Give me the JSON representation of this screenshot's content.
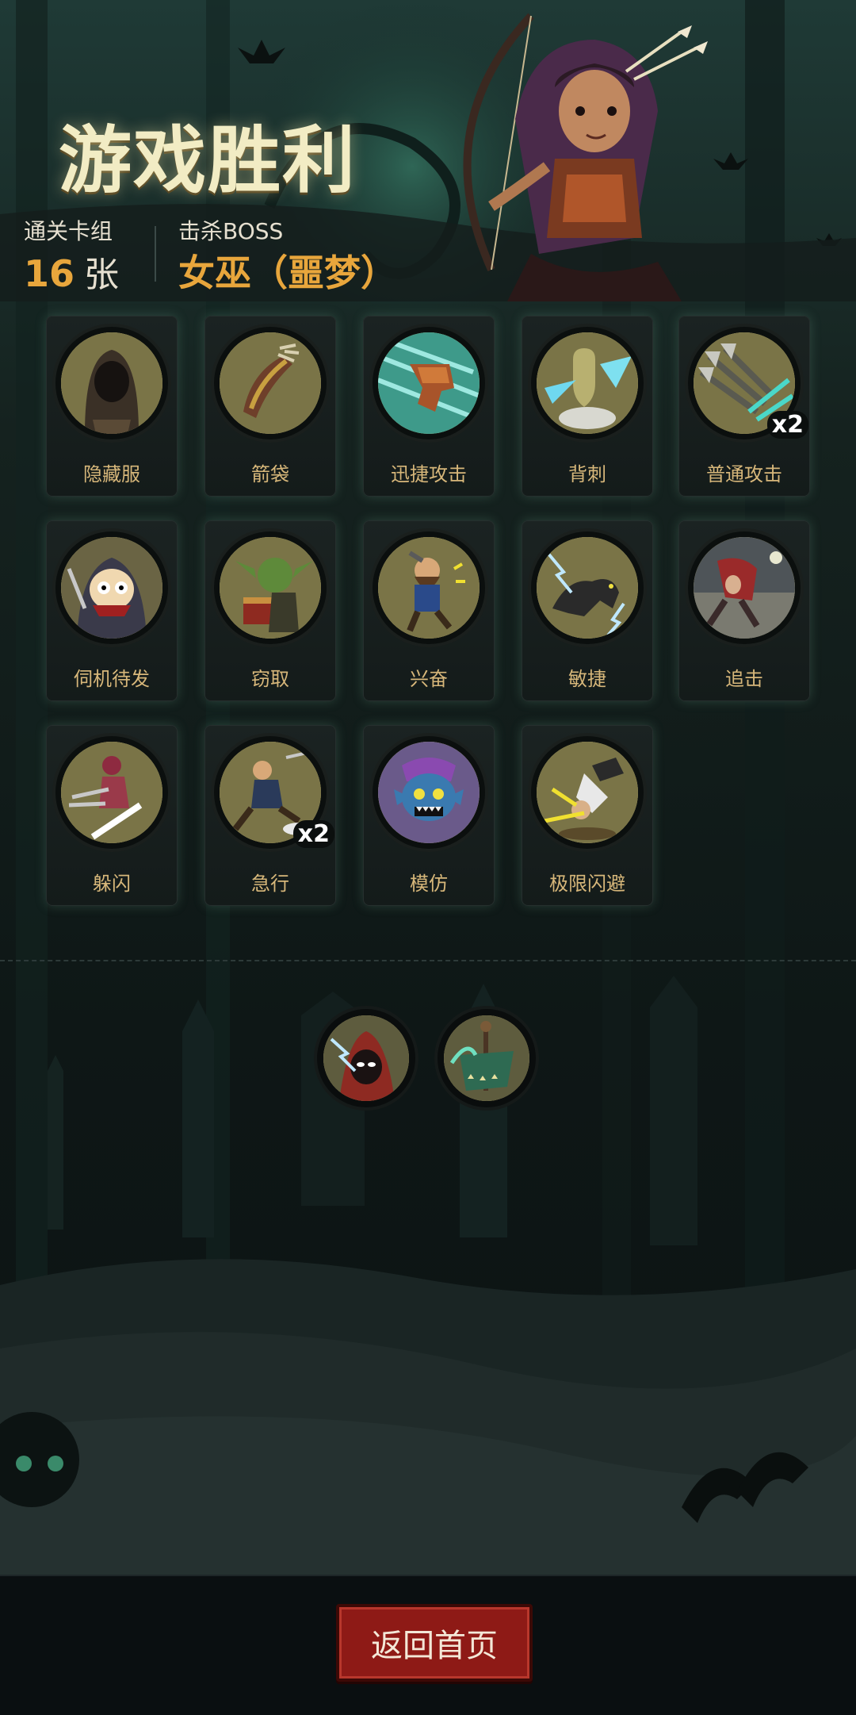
{
  "title": "游戏胜利",
  "stats": {
    "deck_label": "通关卡组",
    "deck_count": "16",
    "deck_unit": "张",
    "boss_label": "击杀BOSS",
    "boss_name": "女巫（噩梦）"
  },
  "cards": [
    {
      "label": "隐藏服",
      "icon": "hood-cloak-icon"
    },
    {
      "label": "箭袋",
      "icon": "quiver-icon"
    },
    {
      "label": "迅捷攻击",
      "icon": "swift-strike-icon"
    },
    {
      "label": "背刺",
      "icon": "backstab-icon"
    },
    {
      "label": "普通攻击",
      "icon": "arrows-attack-icon",
      "badge": "x2"
    },
    {
      "label": "伺机待发",
      "icon": "ready-archer-icon"
    },
    {
      "label": "窃取",
      "icon": "goblin-thief-icon"
    },
    {
      "label": "兴奋",
      "icon": "excited-dwarf-icon"
    },
    {
      "label": "敏捷",
      "icon": "panther-icon"
    },
    {
      "label": "追击",
      "icon": "pursuit-icon"
    },
    {
      "label": "躲闪",
      "icon": "dodge-icon"
    },
    {
      "label": "急行",
      "icon": "dash-icon",
      "badge": "x2"
    },
    {
      "label": "模仿",
      "icon": "mimic-goblin-icon"
    },
    {
      "label": "极限闪避",
      "icon": "extreme-dodge-icon"
    }
  ],
  "relics": [
    {
      "icon": "lightning-hood-relic-icon"
    },
    {
      "icon": "green-banner-relic-icon"
    }
  ],
  "footer": {
    "home_button": "返回首页"
  }
}
